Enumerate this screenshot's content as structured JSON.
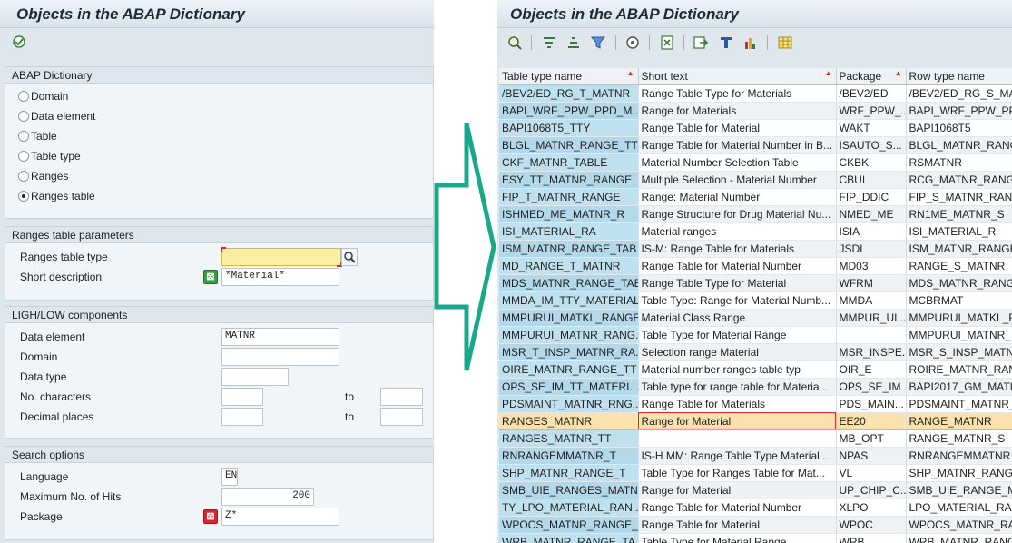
{
  "left": {
    "title": "Objects in the ABAP Dictionary",
    "dictionary_group": {
      "header": "ABAP Dictionary",
      "options": [
        {
          "label": "Domain",
          "selected": false
        },
        {
          "label": "Data element",
          "selected": false
        },
        {
          "label": "Table",
          "selected": false
        },
        {
          "label": "Table type",
          "selected": false
        },
        {
          "label": "Ranges",
          "selected": false
        },
        {
          "label": "Ranges table",
          "selected": true
        }
      ]
    },
    "ranges_params": {
      "header": "Ranges table parameters",
      "type_label": "Ranges table type",
      "type_value": "",
      "desc_label": "Short description",
      "desc_value": "*Material*"
    },
    "high_low": {
      "header": "LIGH/LOW components",
      "data_element_label": "Data element",
      "data_element_value": "MATNR",
      "domain_label": "Domain",
      "domain_value": "",
      "data_type_label": "Data type",
      "data_type_value": "",
      "no_chars_label": "No. characters",
      "no_chars_value": "",
      "no_chars_to": "",
      "decimal_label": "Decimal places",
      "decimal_value": "",
      "decimal_to": "",
      "to_label": "to"
    },
    "search": {
      "header": "Search options",
      "language_label": "Language",
      "language_value": "EN",
      "max_hits_label": "Maximum No. of Hits",
      "max_hits_value": "200",
      "package_label": "Package",
      "package_value": "Z*"
    }
  },
  "right": {
    "title": "Objects in the ABAP Dictionary",
    "columns": [
      "Table type name",
      "Short text",
      "Package",
      "Row type name"
    ],
    "rows": [
      [
        "/BEV2/ED_RG_T_MATNR",
        "Range Table Type for Materials",
        "/BEV2/ED",
        "/BEV2/ED_RG_S_MA"
      ],
      [
        "BAPI_WRF_PPW_PPD_M...",
        "Range for Materials",
        "WRF_PPW_...",
        "BAPI_WRF_PPW_PP"
      ],
      [
        "BAPI1068T5_TTY",
        "Range Table for Material",
        "WAKT",
        "BAPI1068T5"
      ],
      [
        "BLGL_MATNR_RANGE_TT",
        "Range Table for Material Number in B...",
        "ISAUTO_S...",
        "BLGL_MATNR_RANG"
      ],
      [
        "CKF_MATNR_TABLE",
        "Material Number Selection Table",
        "CKBK",
        "RSMATNR"
      ],
      [
        "ESY_TT_MATNR_RANGE",
        "Multiple Selection - Material Number",
        "CBUI",
        "RCG_MATNR_RANGE"
      ],
      [
        "FIP_T_MATNR_RANGE",
        "Range: Material Number",
        "FIP_DDIC",
        "FIP_S_MATNR_RANG"
      ],
      [
        "ISHMED_ME_MATNR_R",
        "Range Structure for Drug Material Nu...",
        "NMED_ME",
        "RN1ME_MATNR_S"
      ],
      [
        "ISI_MATERIAL_RA",
        "Material ranges",
        "ISIA",
        "ISI_MATERIAL_R"
      ],
      [
        "ISM_MATNR_RANGE_TAB",
        "IS-M: Range Table for Materials",
        "JSDI",
        "ISM_MATNR_RANGE"
      ],
      [
        "MD_RANGE_T_MATNR",
        "Range Table for Material Number",
        "MD03",
        "RANGE_S_MATNR"
      ],
      [
        "MDS_MATNR_RANGE_TAB",
        "Range Table Type for Material",
        "WFRM",
        "MDS_MATNR_RANG"
      ],
      [
        "MMDA_IM_TTY_MATERIAL",
        "Table Type: Range for Material Numb...",
        "MMDA",
        "MCBRMAT"
      ],
      [
        "MMPURUI_MATKL_RANGE...",
        "Material Class Range",
        "MMPUR_UI...",
        "MMPURUI_MATKL_R"
      ],
      [
        "MMPURUI_MATNR_RANG...",
        "Table Type for Material Range",
        "",
        "MMPURUI_MATNR_R"
      ],
      [
        "MSR_T_INSP_MATNR_RA...",
        "Selection range Material",
        "MSR_INSPE...",
        "MSR_S_INSP_MATNI"
      ],
      [
        "OIRE_MATNR_RANGE_TT",
        "Material number ranges table typ",
        "OIR_E",
        "ROIRE_MATNR_RAN"
      ],
      [
        "OPS_SE_IM_TT_MATERI...",
        "Table type for range table for Materia...",
        "OPS_SE_IM",
        "BAPI2017_GM_MATI"
      ],
      [
        "PDSMAINT_MATNR_RNG...",
        "Range Table for Materials",
        "PDS_MAIN...",
        "PDSMAINT_MATNR_"
      ],
      [
        "RANGES_MATNR",
        "Range for Material",
        "EE20",
        "RANGE_MATNR"
      ],
      [
        "RANGES_MATNR_TT",
        "",
        "MB_OPT",
        "RANGE_MATNR_S"
      ],
      [
        "RNRANGEMMATNR_T",
        "IS-H MM: Range Table Type Material ...",
        "NPAS",
        "RNRANGEMMATNR"
      ],
      [
        "SHP_MATNR_RANGE_T",
        "Table Type for Ranges Table for Mat...",
        "VL",
        "SHP_MATNR_RANGE"
      ],
      [
        "SMB_UIE_RANGES_MATNR",
        "Range for Material",
        "UP_CHIP_C...",
        "SMB_UIE_RANGE_MA"
      ],
      [
        "TY_LPO_MATERIAL_RAN...",
        "Range Table for Material Number",
        "XLPO",
        "LPO_MATERIAL_RAN"
      ],
      [
        "WPOCS_MATNR_RANGE_...",
        "Range Table for Material",
        "WPOC",
        "WPOCS_MATNR_RAN"
      ],
      [
        "WRB_MATNR_RANGE_TA...",
        "Table Type for Material Range",
        "WRB",
        "WRB_MATNR_RANG"
      ]
    ],
    "selected_row": 19
  },
  "colors": {
    "frame_bg": "#dfe6ec",
    "key_column": "#bfe0ef",
    "selected_row": "#fbe1ad",
    "arrow": "#19a88c",
    "required_field": "#fbeea0"
  }
}
